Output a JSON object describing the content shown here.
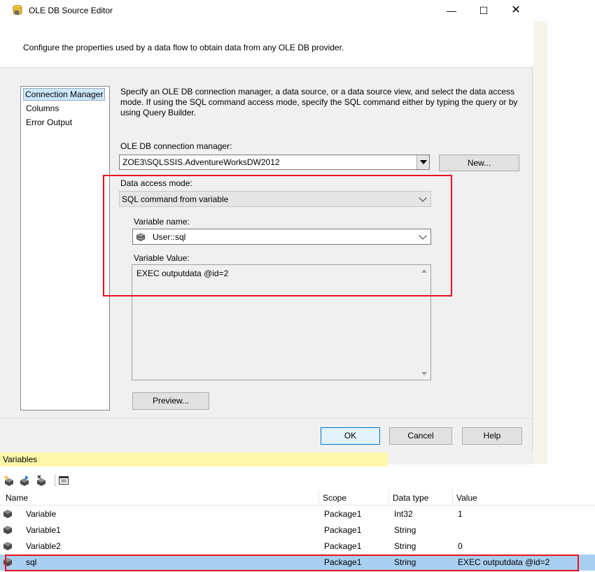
{
  "dialog": {
    "title": "OLE DB Source Editor",
    "window_controls": {
      "minimize": "—",
      "maximize": "☐",
      "close": "✕"
    },
    "description": "Configure the properties used by a data flow to obtain data from any OLE DB provider."
  },
  "nav": {
    "items": [
      {
        "label": "Connection Manager",
        "selected": true
      },
      {
        "label": "Columns",
        "selected": false
      },
      {
        "label": "Error Output",
        "selected": false
      }
    ]
  },
  "content": {
    "description": "Specify an OLE DB connection manager, a data source, or a data source view, and select the data access mode. If using the SQL command access mode, specify the SQL command either by typing the query or by using Query Builder.",
    "connection_manager_label": "OLE DB connection manager:",
    "connection_manager_value": "ZOE3\\SQLSSIS.AdventureWorksDW2012",
    "new_button": "New...",
    "data_access_mode_label": "Data access mode:",
    "data_access_mode_value": "SQL command from variable",
    "variable_name_label": "Variable name:",
    "variable_name_value": "User::sql",
    "variable_value_label": "Variable Value:",
    "variable_value": "EXEC outputdata  @id=2",
    "preview_button": "Preview..."
  },
  "footer": {
    "ok": "OK",
    "cancel": "Cancel",
    "help": "Help"
  },
  "variables_panel": {
    "title": "Variables",
    "columns": [
      "Name",
      "Scope",
      "Data type",
      "Value"
    ],
    "rows": [
      {
        "name": "Variable",
        "scope": "Package1",
        "type": "Int32",
        "value": "1",
        "selected": false
      },
      {
        "name": "Variable1",
        "scope": "Package1",
        "type": "String",
        "value": "",
        "selected": false
      },
      {
        "name": "Variable2",
        "scope": "Package1",
        "type": "String",
        "value": "0",
        "selected": false
      },
      {
        "name": "sql",
        "scope": "Package1",
        "type": "String",
        "value": "EXEC outputdata  @id=2",
        "selected": true
      }
    ]
  },
  "colors": {
    "highlight_red": "#e81123",
    "selection_blue": "#a9cff0",
    "panel_title_yellow": "#fdf7a9"
  }
}
